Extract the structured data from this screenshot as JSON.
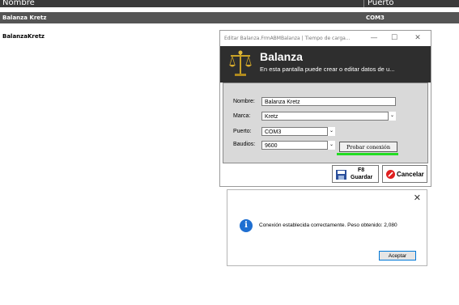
{
  "grid": {
    "headers": {
      "nombre": "Nombre",
      "puerto": "Puerto"
    },
    "rows": [
      {
        "nombre": "Balanza Kretz",
        "puerto": "COM3"
      },
      {
        "nombre": "BalanzaKretz",
        "puerto": ""
      }
    ]
  },
  "edit_window": {
    "title": "Editar Balanza.FrmABMBalanza | Tiempo de carga...",
    "controls": {
      "minimize": "—",
      "maximize": "☐",
      "close": "✕"
    },
    "banner": {
      "icon": "scale-icon",
      "title": "Balanza",
      "subtitle": "En esta pantalla puede crear o editar datos de u..."
    },
    "form": {
      "nombre_label": "Nombre:",
      "nombre_value": "Balanza Kretz",
      "marca_label": "Marca:",
      "marca_value": "Kretz",
      "puerto_label": "Puerto:",
      "puerto_value": "COM3",
      "baudios_label": "Baudios:",
      "baudios_value": "9600",
      "probar_label": "Probar conexión"
    },
    "buttons": {
      "guardar_key": "F8",
      "guardar_label": "Guardar",
      "cancelar_label": "Cancelar"
    }
  },
  "message_box": {
    "icon": "info-icon",
    "text": "Conexión establecida correctamente. Peso obtenido: 2,080",
    "ok_label": "Aceptar",
    "close": "✕"
  }
}
